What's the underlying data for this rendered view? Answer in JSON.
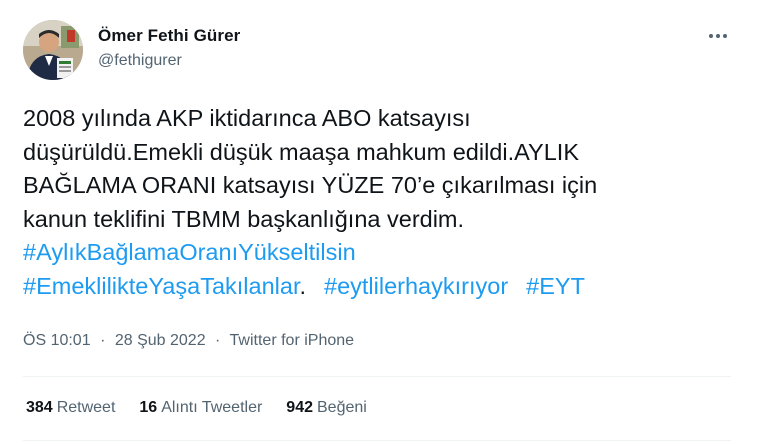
{
  "author": {
    "name": "Ömer Fethi Gürer",
    "handle": "@fethigurer"
  },
  "tweet": {
    "lines": [
      "2008 yılında AKP iktidarınca ABO katsayısı",
      "düşürüldü.Emekli düşük maaşa mahkum edildi.AYLIK",
      "BAĞLAMA ORANI katsayısı YÜZE 70’e çıkarılması için",
      "kanun teklifini TBMM başkanlığına verdim."
    ],
    "hashtags": [
      "#AylıkBağlamaOranıYükseltilsin",
      "#EmeklilikteYaşaTakılanlar",
      "#eytlilerhaykırıyor",
      "#EYT"
    ],
    "trailing_period": "."
  },
  "meta": {
    "time": "ÖS 10:01",
    "separator": "·",
    "date": "28 Şub 2022",
    "source": "Twitter for iPhone"
  },
  "stats": {
    "retweets": {
      "count": "384",
      "label": "Retweet"
    },
    "quotes": {
      "count": "16",
      "label": "Alıntı Tweetler"
    },
    "likes": {
      "count": "942",
      "label": "Beğeni"
    }
  },
  "colors": {
    "text": "#0f1419",
    "secondary": "#536471",
    "link": "#1d9bf0",
    "divider": "#eff3f4"
  },
  "icons": {
    "more": "more-horizontal-icon"
  }
}
